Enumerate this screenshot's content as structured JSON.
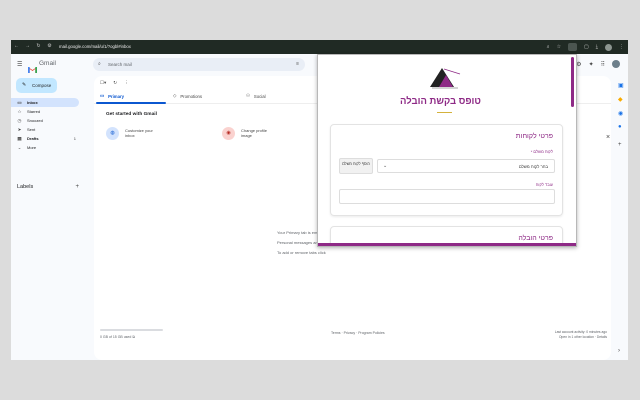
{
  "browser": {
    "url": "mail.google.com/mail/u/1/?ogbl#inbox",
    "nav_icons": [
      "back-icon",
      "forward-icon",
      "reload-icon",
      "site-info-icon"
    ],
    "toolbar_icons": [
      "zoom-icon",
      "bookmark-star-icon",
      "extension-active-icon",
      "tab-search-icon",
      "download-icon",
      "profile-avatar",
      "menu-icon"
    ]
  },
  "gmail": {
    "brand": "Gmail",
    "search_placeholder": "Search mail",
    "compose_label": "Compose",
    "nav": [
      {
        "label": "Inbox",
        "icon": "inbox-icon",
        "count": "",
        "active": true
      },
      {
        "label": "Starred",
        "icon": "star-icon",
        "count": ""
      },
      {
        "label": "Snoozed",
        "icon": "clock-icon",
        "count": ""
      },
      {
        "label": "Sent",
        "icon": "send-icon",
        "count": ""
      },
      {
        "label": "Drafts",
        "icon": "draft-icon",
        "count": "1"
      },
      {
        "label": "More",
        "icon": "chevron-down-icon",
        "count": ""
      }
    ],
    "labels_heading": "Labels",
    "tabs": [
      {
        "label": "Primary",
        "icon": "inbox-icon",
        "active": true
      },
      {
        "label": "Promotions",
        "icon": "tag-icon"
      },
      {
        "label": "Social",
        "icon": "people-icon"
      }
    ],
    "started_title": "Get started with Gmail",
    "cards": [
      {
        "label": "Customize your inbox",
        "icon": "palette-icon",
        "color": "#d3e3fd"
      },
      {
        "label": "Change profile image",
        "icon": "profile-icon",
        "color": "#fad2cf"
      }
    ],
    "empty_lines": [
      "Your Primary tab is emp",
      "Personal messages and m",
      "To add or remove tabs click"
    ],
    "storage_used": "0 GB of 15 GB used",
    "footer_links": "Terms · Privacy · Program Policies",
    "last_activity": "Last account activity: 0 minutes ago",
    "open_details": "Open in 1 other location · Details"
  },
  "popup": {
    "title": "טופס בקשת הובלה",
    "section1_title": "פרטי לקוחות",
    "payer_label": "לקוח משלם *",
    "payer_select": "בחר לקוח משלם",
    "add_button": "הוסף לקוח משלם",
    "customer_label": "עובד לקוח",
    "section2_title": "פרטי הובלה",
    "accent_color": "#8e2a86"
  }
}
